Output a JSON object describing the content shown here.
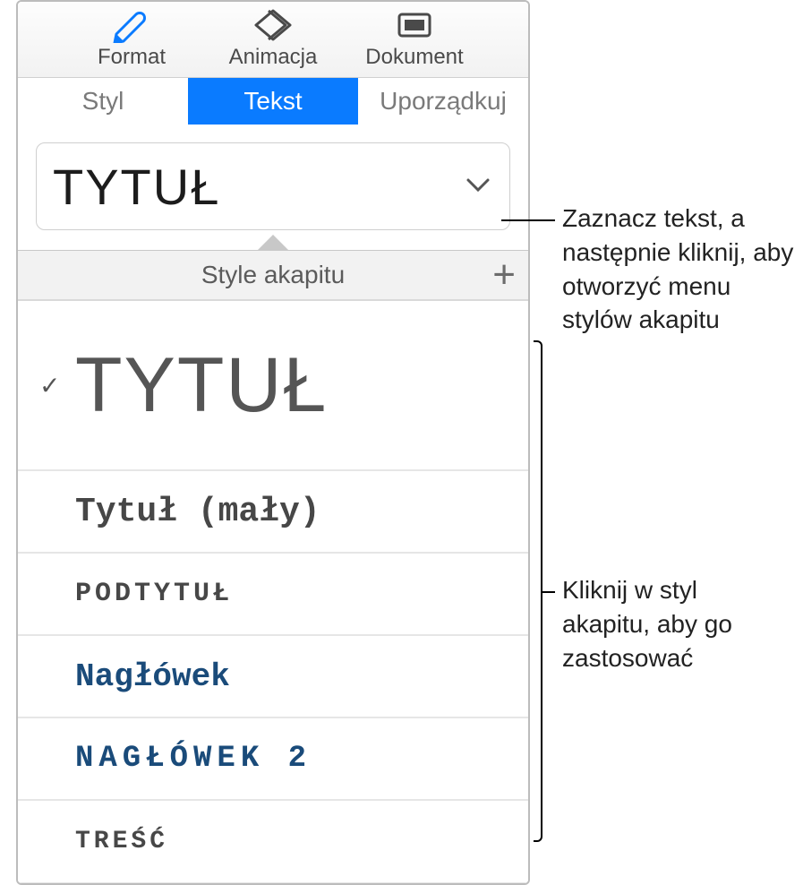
{
  "toolbar": {
    "format": "Format",
    "animate": "Animacja",
    "document": "Dokument"
  },
  "subtabs": {
    "style": "Styl",
    "text": "Tekst",
    "arrange": "Uporządkuj"
  },
  "current_style": {
    "label": "TYTUŁ"
  },
  "popup": {
    "title": "Style akapitu",
    "items": [
      {
        "label": "TYTUŁ",
        "selected": true,
        "variant": "tytul"
      },
      {
        "label": "Tytuł (mały)",
        "selected": false,
        "variant": "maly"
      },
      {
        "label": "PODTYTUŁ",
        "selected": false,
        "variant": "pod"
      },
      {
        "label": "Nagłówek",
        "selected": false,
        "variant": "nag"
      },
      {
        "label": "NAGŁÓWEK 2",
        "selected": false,
        "variant": "nag2"
      },
      {
        "label": "TREŚĆ",
        "selected": false,
        "variant": "tresc"
      }
    ]
  },
  "callouts": {
    "top": "Zaznacz tekst, a następnie kliknij, aby otworzyć menu stylów akapitu",
    "bottom": "Kliknij w styl akapitu, aby go zastosować"
  }
}
